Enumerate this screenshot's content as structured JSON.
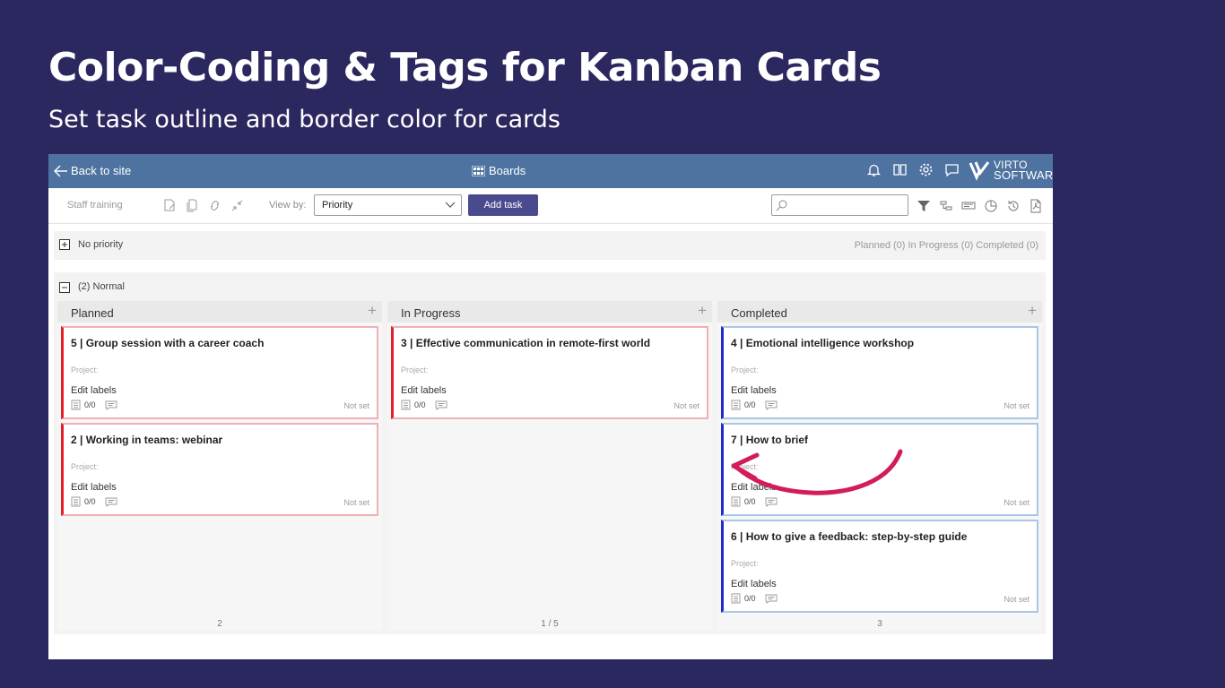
{
  "slide": {
    "headline": "Color-Coding & Tags for Kanban Cards",
    "subline": "Set task outline and border color for cards"
  },
  "topbar": {
    "back_label": "Back to site",
    "boards_label": "Boards",
    "logo_line1": "VIRTO",
    "logo_line2": "SOFTWARE",
    "icons": [
      "bell-icon",
      "book-icon",
      "gear-icon",
      "chat-icon"
    ]
  },
  "toolbar": {
    "board_name": "Staff training",
    "viewby_label": "View by:",
    "viewby_value": "Priority",
    "add_task_label": "Add task",
    "search_placeholder": ""
  },
  "groups": {
    "no_priority": {
      "label": "No priority",
      "summary": "Planned (0) In Progress (0) Completed (0)"
    },
    "normal": {
      "label": "(2) Normal"
    }
  },
  "columns": [
    {
      "name": "Planned",
      "footer": "2",
      "cards": [
        {
          "title": "5 | Group session with a career coach",
          "project": "Project:",
          "labels": "Edit labels",
          "count": "0/0",
          "due": "Not set",
          "color": "#e0202a",
          "outline": "#efb1b4"
        },
        {
          "title": "2 | Working in teams: webinar",
          "project": "Project:",
          "labels": "Edit labels",
          "count": "0/0",
          "due": "Not set",
          "color": "#e0202a",
          "outline": "#efb1b4"
        }
      ]
    },
    {
      "name": "In Progress",
      "footer": "1  /  5",
      "cards": [
        {
          "title": "3 | Effective communication in remote-first world",
          "project": "Project:",
          "labels": "Edit labels",
          "count": "0/0",
          "due": "Not set",
          "color": "#e0202a",
          "outline": "#efb1b4"
        }
      ]
    },
    {
      "name": "Completed",
      "footer": "3",
      "cards": [
        {
          "title": "4 | Emotional intelligence workshop",
          "project": "Project:",
          "labels": "Edit labels",
          "count": "0/0",
          "due": "Not set",
          "color": "#1f2bd0",
          "outline": "#a9c6e6"
        },
        {
          "title": "7 | How to brief",
          "project": "Project:",
          "labels": "Edit labels",
          "count": "0/0",
          "due": "Not set",
          "color": "#1f2bd0",
          "outline": "#a9c6e6"
        },
        {
          "title": "6 | How to give a feedback: step-by-step guide",
          "project": "Project:",
          "labels": "Edit labels",
          "count": "0/0",
          "due": "Not set",
          "color": "#1f2bd0",
          "outline": "#a9c6e6"
        }
      ]
    }
  ],
  "colors": {
    "background": "#2b275f",
    "topbar": "#4e73a0",
    "add_button": "#4a4b8f",
    "annotation_arrow": "#d21c5c"
  }
}
